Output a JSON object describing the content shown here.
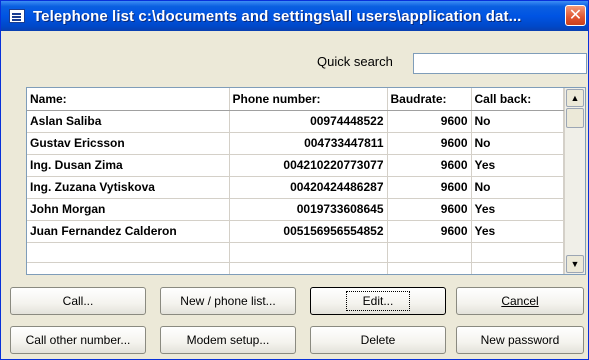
{
  "window": {
    "title": "Telephone list  c:\\documents and settings\\all users\\application dat...",
    "close_glyph": "✕"
  },
  "search": {
    "label": "Quick search",
    "value": ""
  },
  "table": {
    "headers": [
      "Name:",
      "Phone number:",
      "Baudrate:",
      "Call back:"
    ],
    "rows": [
      [
        "Aslan Saliba",
        "00974448522",
        "9600",
        "No"
      ],
      [
        "Gustav Ericsson",
        "004733447811",
        "9600",
        "No"
      ],
      [
        "Ing. Dusan Zima",
        "004210220773077",
        "9600",
        "Yes"
      ],
      [
        "Ing. Zuzana Vytiskova",
        "00420424486287",
        "9600",
        "No"
      ],
      [
        "John Morgan",
        "0019733608645",
        "9600",
        "Yes"
      ],
      [
        "Juan Fernandez Calderon",
        "005156956554852",
        "9600",
        "Yes"
      ]
    ]
  },
  "scrollbar": {
    "up_glyph": "▲",
    "down_glyph": "▼"
  },
  "buttons": {
    "call": "Call...",
    "new_phone_list": "New / phone list...",
    "edit": "Edit...",
    "cancel": "Cancel",
    "call_other": "Call other number...",
    "modem_setup": "Modem setup...",
    "delete": "Delete",
    "new_password": "New password"
  }
}
